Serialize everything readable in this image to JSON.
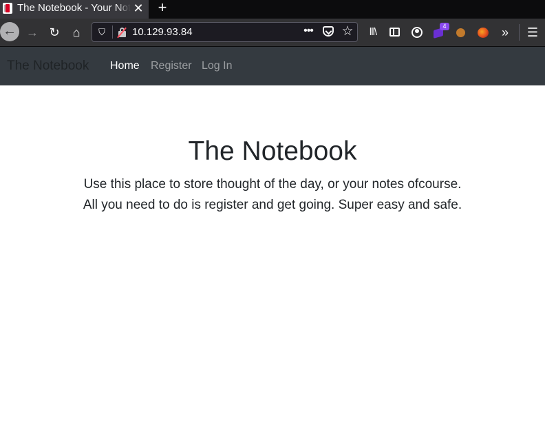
{
  "browser": {
    "tab_title": "The Notebook - Your Notes",
    "tab_close": "✕",
    "new_tab": "+",
    "url": "10.129.93.84",
    "page_actions": "•••",
    "extension_badge": "4",
    "icons": {
      "back": "←",
      "forward": "→",
      "reload": "↻",
      "home": "⌂",
      "shield": "⛉",
      "star": "☆",
      "library": "lll\\",
      "overflow": "»",
      "menu": "☰"
    }
  },
  "site": {
    "brand": "The Notebook",
    "nav": {
      "home": "Home",
      "register": "Register",
      "login": "Log In"
    },
    "hero": {
      "title": "The Notebook",
      "line1": "Use this place to store thought of the day, or your notes ofcourse.",
      "line2": "All you need to do is register and get going. Super easy and safe."
    }
  },
  "colors": {
    "browser_chrome": "#323234",
    "tab_active": "#38383d",
    "site_navbar": "#343a40",
    "link_active": "#ffffff",
    "text_dark": "#212529"
  }
}
